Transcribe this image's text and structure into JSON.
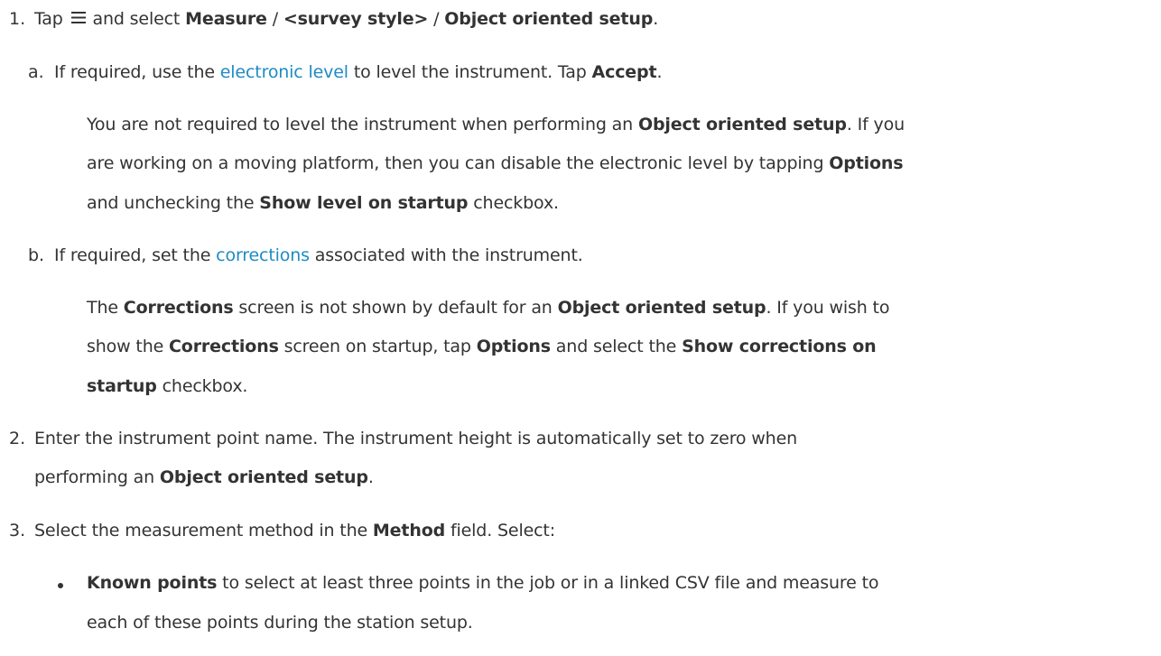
{
  "step1": {
    "number": "1.",
    "pre": "Tap ",
    "mid": " and select ",
    "b1": "Measure",
    "sep1": " / ",
    "b2": "<survey style>",
    "sep2": " / ",
    "b3": "Object oriented setup",
    "end": ".",
    "icon": "hamburger-menu-icon"
  },
  "step1a": {
    "letter": "a.",
    "pre": "If required, use the ",
    "link": "electronic level",
    "post": " to level the instrument. Tap ",
    "b1": "Accept",
    "end": ".",
    "note": {
      "l1_pre": "You are not required to level the instrument when performing an ",
      "l1_b": "Object oriented setup",
      "l1_post": ". If you",
      "l2_pre": "are working on a moving platform, then you can disable the electronic level by tapping ",
      "l2_b": "Options",
      "l3_pre": "and unchecking the ",
      "l3_b": "Show level on startup",
      "l3_post": " checkbox."
    }
  },
  "step1b": {
    "letter": "b.",
    "pre": "If required, set the ",
    "link": "corrections",
    "post": " associated with the instrument.",
    "note": {
      "l1_pre": "The ",
      "l1_b1": "Corrections",
      "l1_mid": " screen is not shown by default for an ",
      "l1_b2": "Object oriented setup",
      "l1_post": ". If you wish to",
      "l2_pre": "show the ",
      "l2_b1": "Corrections",
      "l2_mid": " screen on startup, tap ",
      "l2_b2": "Options",
      "l2_mid2": " and select the ",
      "l2_b3": "Show corrections on",
      "l3_b": "startup",
      "l3_post": " checkbox."
    }
  },
  "step2": {
    "number": "2.",
    "l1": "Enter the instrument point name. The instrument height is automatically set to zero when",
    "l2_pre": "performing an ",
    "l2_b": "Object oriented setup",
    "l2_post": "."
  },
  "step3": {
    "number": "3.",
    "pre": "Select the measurement method in the ",
    "b": "Method",
    "post": " field. Select:",
    "bullet1": {
      "b": "Known points",
      "l1_post": " to select at least three points in the job or in a linked CSV file and measure to",
      "l2": "each of these points during the station setup."
    }
  }
}
